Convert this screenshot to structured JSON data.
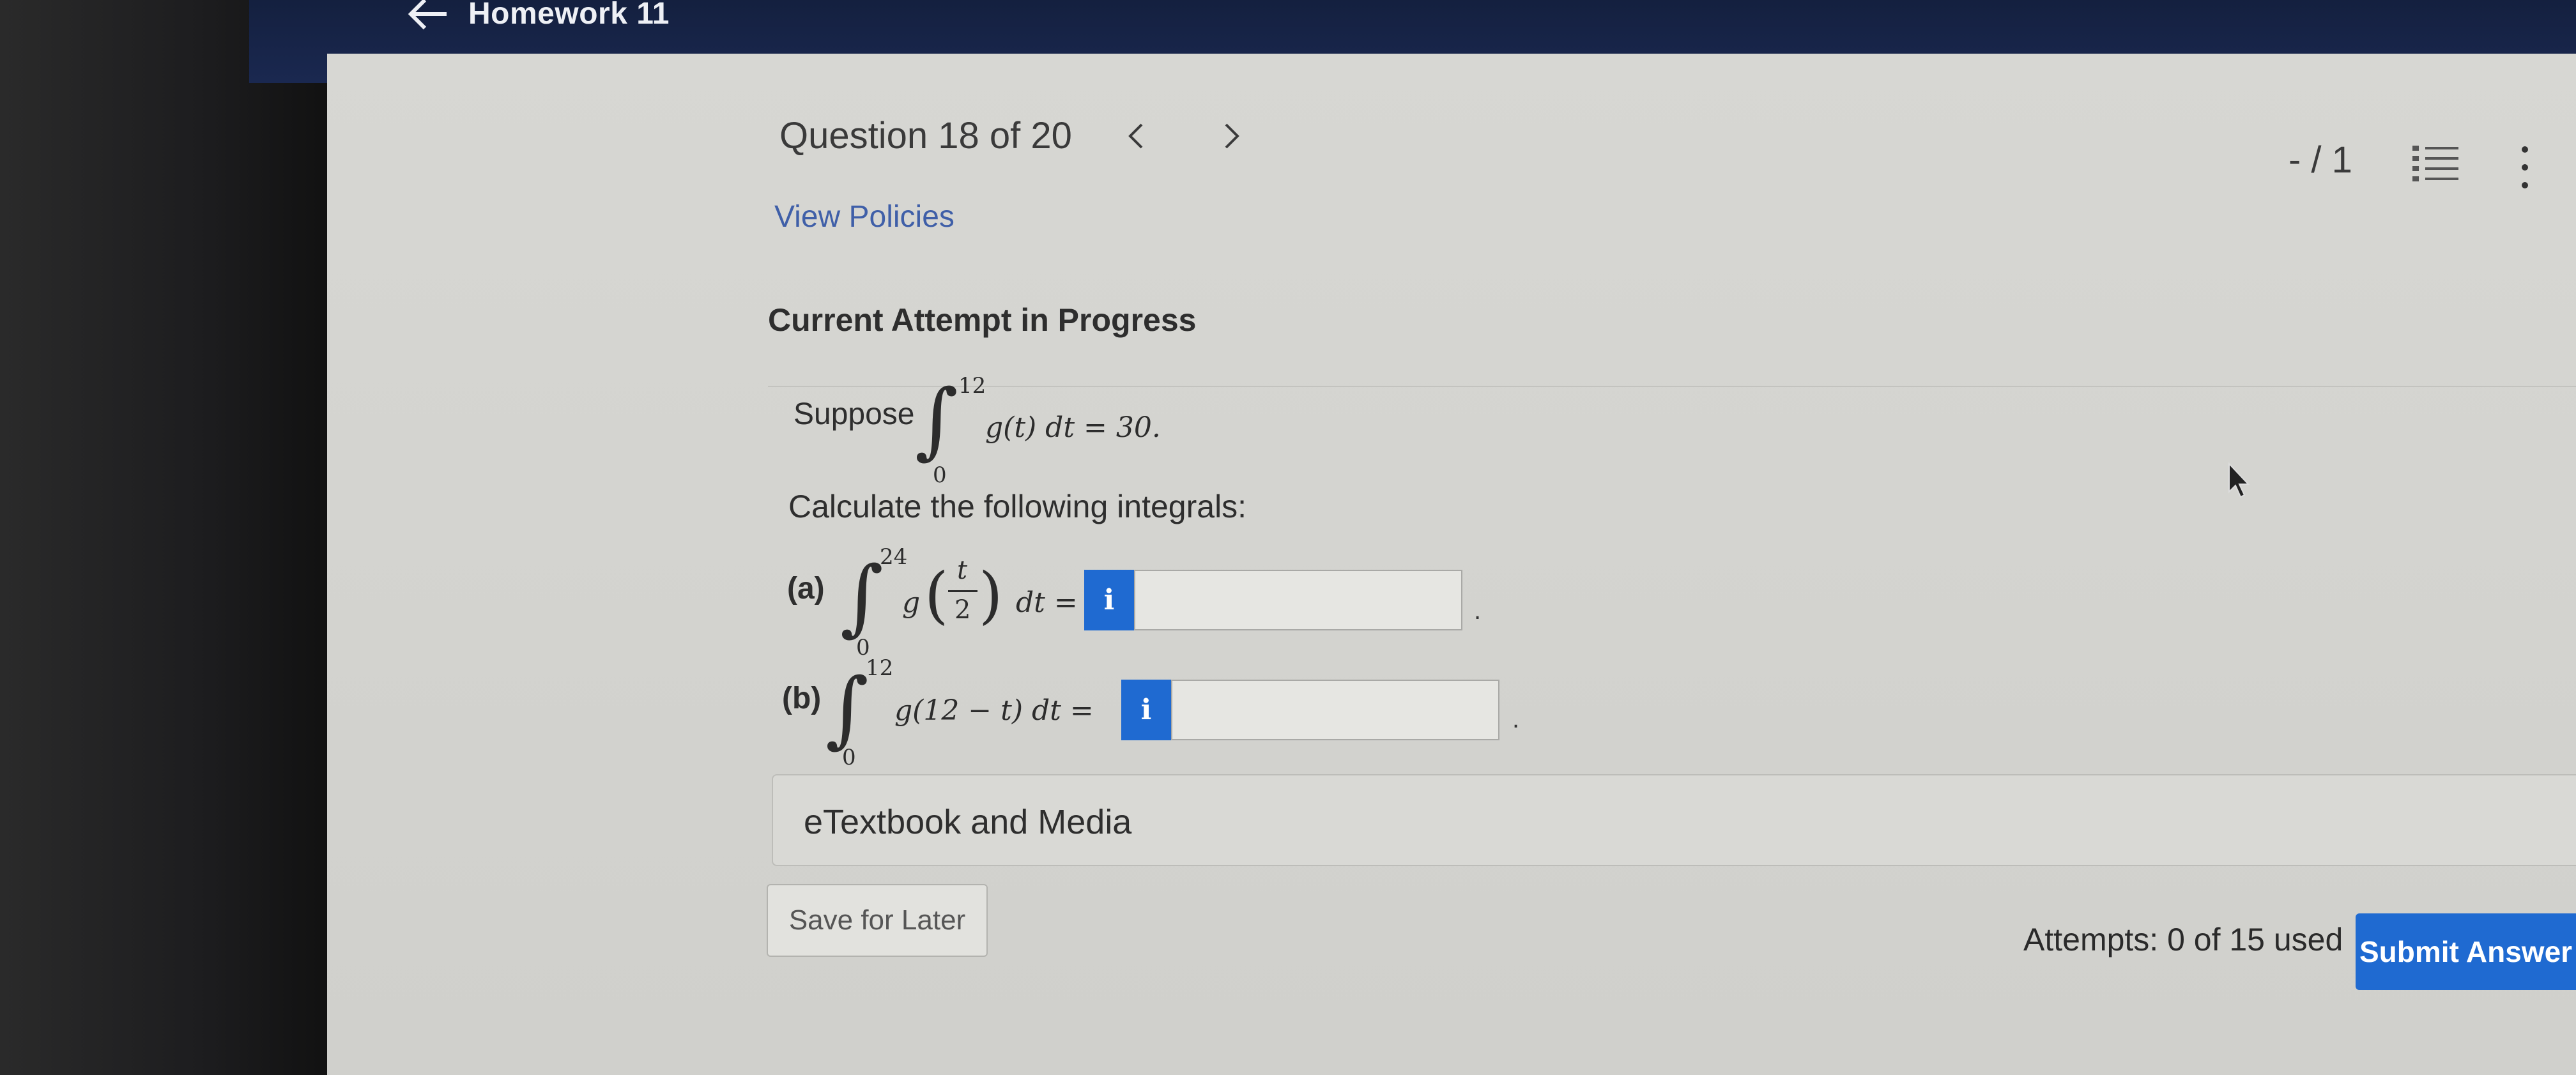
{
  "header": {
    "title": "Homework 11"
  },
  "question_nav": {
    "title": "Question 18 of 20",
    "prev_symbol": "<",
    "next_symbol": ">",
    "points": "- / 1"
  },
  "links": {
    "view_policies": "View Policies"
  },
  "attempt": {
    "heading": "Current Attempt in Progress"
  },
  "problem": {
    "suppose_text": "Suppose",
    "given": {
      "upper": "12",
      "lower": "0",
      "integrand": "g(t) dt = 30."
    },
    "instruction": "Calculate the following integrals:",
    "part_a": {
      "label": "(a)",
      "upper": "24",
      "lower": "0",
      "integrand_left": "g",
      "frac_num": "t",
      "frac_den": "2",
      "integrand_right": "dt =",
      "answer_value": ""
    },
    "part_b": {
      "label": "(b)",
      "upper": "12",
      "lower": "0",
      "integrand": "g(12 − t) dt =",
      "answer_value": ""
    },
    "info_symbol": "i",
    "period": "."
  },
  "etextbook": {
    "label": "eTextbook and Media"
  },
  "footer": {
    "save_label": "Save for Later",
    "attempts_text": "Attempts: 0 of 15 used",
    "submit_label": "Submit Answer"
  },
  "colors": {
    "accent": "#1f6ad1",
    "header_bg": "#1a2850",
    "link": "#3f5fa8"
  },
  "icons": [
    "arrow-left-icon",
    "chevron-left-icon",
    "chevron-right-icon",
    "numbered-list-icon",
    "more-vertical-icon",
    "mouse-cursor-icon"
  ]
}
